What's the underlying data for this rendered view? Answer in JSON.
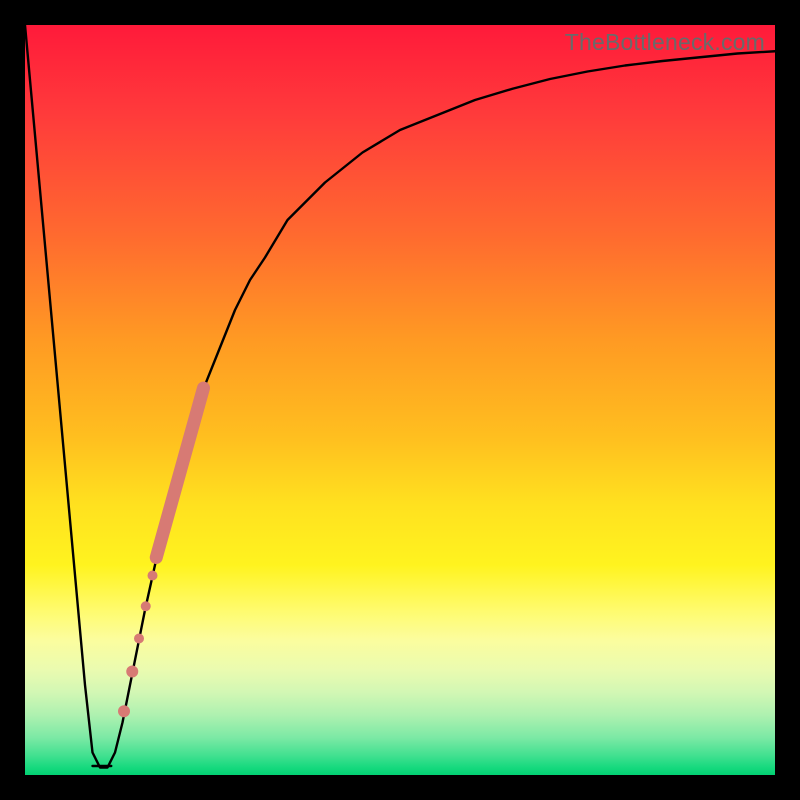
{
  "watermark": "TheBottleneck.com",
  "chart_data": {
    "type": "line",
    "title": "",
    "xlabel": "",
    "ylabel": "",
    "xlim": [
      0,
      100
    ],
    "ylim": [
      0,
      100
    ],
    "series": [
      {
        "name": "bottleneck-curve",
        "x": [
          0,
          2,
          4,
          6,
          8,
          9,
          10,
          11,
          12,
          13,
          14,
          16,
          18,
          20,
          22,
          24,
          26,
          28,
          30,
          32,
          35,
          40,
          45,
          50,
          55,
          60,
          65,
          70,
          75,
          80,
          85,
          90,
          95,
          100
        ],
        "y": [
          100,
          78,
          56,
          34,
          12,
          3,
          1,
          1,
          3,
          7,
          12,
          22,
          31,
          39,
          46,
          52,
          57,
          62,
          66,
          69,
          74,
          79,
          83,
          86,
          88,
          90,
          91.5,
          92.8,
          93.8,
          94.6,
          95.2,
          95.7,
          96.2,
          96.5
        ]
      }
    ],
    "highlight_points": {
      "name": "highlighted-range",
      "color": "#d77a74",
      "points": [
        {
          "x": 13.2,
          "y": 8.5,
          "r": 6
        },
        {
          "x": 14.3,
          "y": 13.8,
          "r": 6
        },
        {
          "x": 15.2,
          "y": 18.2,
          "r": 5
        },
        {
          "x": 16.1,
          "y": 22.5,
          "r": 5
        },
        {
          "x": 17.0,
          "y": 26.6,
          "r": 5
        }
      ],
      "thick_segment": {
        "x0": 17.5,
        "y0": 29.0,
        "x1": 23.8,
        "y1": 51.6
      }
    },
    "flat_bottom": {
      "x0": 9.0,
      "x1": 11.5,
      "y": 1.2
    }
  }
}
